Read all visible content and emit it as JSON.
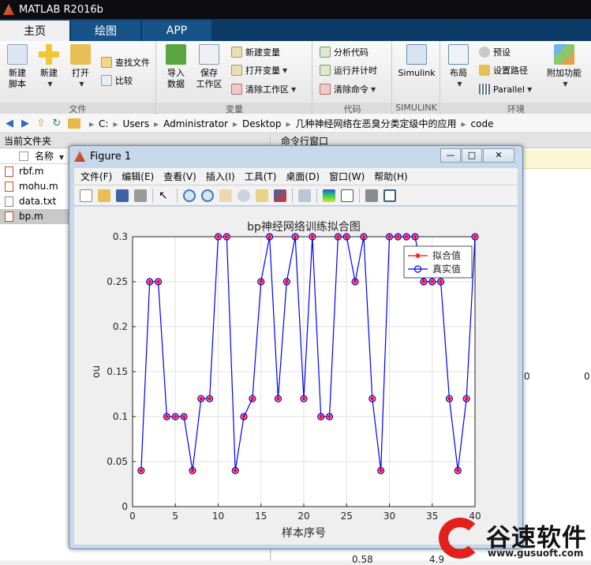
{
  "app": {
    "title": "MATLAB R2016b"
  },
  "tabs": [
    {
      "label": "主页"
    },
    {
      "label": "绘图"
    },
    {
      "label": "APP"
    }
  ],
  "ribbon": {
    "file": {
      "label": "文件",
      "new_script": "新建\n脚本",
      "new": "新建",
      "open": "打开",
      "find_files": "查找文件",
      "compare": "比较"
    },
    "variable": {
      "label": "变量",
      "import": "导入\n数据",
      "save_ws": "保存\n工作区",
      "new_var": "新建变量",
      "open_var": "打开变量",
      "clear_ws": "清除工作区"
    },
    "code": {
      "label": "代码",
      "analyze": "分析代码",
      "run_time": "运行并计时",
      "clear_cmd": "清除命令"
    },
    "simulink": {
      "label": "SIMULINK",
      "button": "Simulink"
    },
    "env": {
      "label": "环境",
      "layout": "布局",
      "prefs": "预设",
      "set_path": "设置路径",
      "parallel": "Parallel",
      "addons": "附加功能"
    }
  },
  "path": {
    "segments": [
      "C:",
      "Users",
      "Administrator",
      "Desktop",
      "几种神经网络在恶臭分类定级中的应用",
      "code"
    ]
  },
  "left_panel": {
    "title": "当前文件夹",
    "column_name": "名称",
    "files": [
      {
        "name": "rbf.m"
      },
      {
        "name": "mohu.m"
      },
      {
        "name": "data.txt"
      },
      {
        "name": "bp.m"
      }
    ]
  },
  "right_panel": {
    "title": "命令行窗口",
    "ws_zero_a": "0",
    "ws_zero_b": "0",
    "ws_bottom": "0.58",
    "ws_bottom2": "4.9"
  },
  "figure": {
    "title": "Figure 1",
    "menu": [
      "文件(F)",
      "编辑(E)",
      "查看(V)",
      "插入(I)",
      "工具(T)",
      "桌面(D)",
      "窗口(W)",
      "帮助(H)"
    ],
    "min": "—",
    "max": "□",
    "close": "✕"
  },
  "watermark": {
    "text": "谷速软件",
    "url": "www.gusuoft.com"
  },
  "chart_data": {
    "type": "line",
    "title": "bp神经网络训练拟合图",
    "xlabel": "样本序号",
    "ylabel": "ou",
    "xlim": [
      0,
      40
    ],
    "ylim": [
      0,
      0.3
    ],
    "xticks": [
      0,
      5,
      10,
      15,
      20,
      25,
      30,
      35,
      40
    ],
    "yticks": [
      0,
      0.05,
      0.1,
      0.15,
      0.2,
      0.25,
      0.3
    ],
    "grid": true,
    "legend_position": "top-right",
    "x": [
      1,
      2,
      3,
      4,
      5,
      6,
      7,
      8,
      9,
      10,
      11,
      12,
      13,
      14,
      15,
      16,
      17,
      18,
      19,
      20,
      21,
      22,
      23,
      24,
      25,
      26,
      27,
      28,
      29,
      30,
      31,
      32,
      33,
      34,
      35,
      36,
      37,
      38,
      39,
      40
    ],
    "series": [
      {
        "name": "拟合值",
        "color": "#ff0000",
        "marker": "*",
        "values": [
          0.04,
          0.25,
          0.25,
          0.1,
          0.1,
          0.1,
          0.04,
          0.12,
          0.12,
          0.3,
          0.3,
          0.04,
          0.1,
          0.12,
          0.25,
          0.3,
          0.12,
          0.25,
          0.3,
          0.12,
          0.3,
          0.1,
          0.1,
          0.3,
          0.3,
          0.25,
          0.3,
          0.12,
          0.04,
          0.3,
          0.3,
          0.3,
          0.3,
          0.25,
          0.25,
          0.25,
          0.12,
          0.04,
          0.12,
          0.3
        ]
      },
      {
        "name": "真实值",
        "color": "#0000ff",
        "marker": "o",
        "values": [
          0.04,
          0.25,
          0.25,
          0.1,
          0.1,
          0.1,
          0.04,
          0.12,
          0.12,
          0.3,
          0.3,
          0.04,
          0.1,
          0.12,
          0.25,
          0.3,
          0.12,
          0.25,
          0.3,
          0.12,
          0.3,
          0.1,
          0.1,
          0.3,
          0.3,
          0.25,
          0.3,
          0.12,
          0.04,
          0.3,
          0.3,
          0.3,
          0.3,
          0.25,
          0.25,
          0.25,
          0.12,
          0.04,
          0.12,
          0.3
        ]
      }
    ]
  }
}
